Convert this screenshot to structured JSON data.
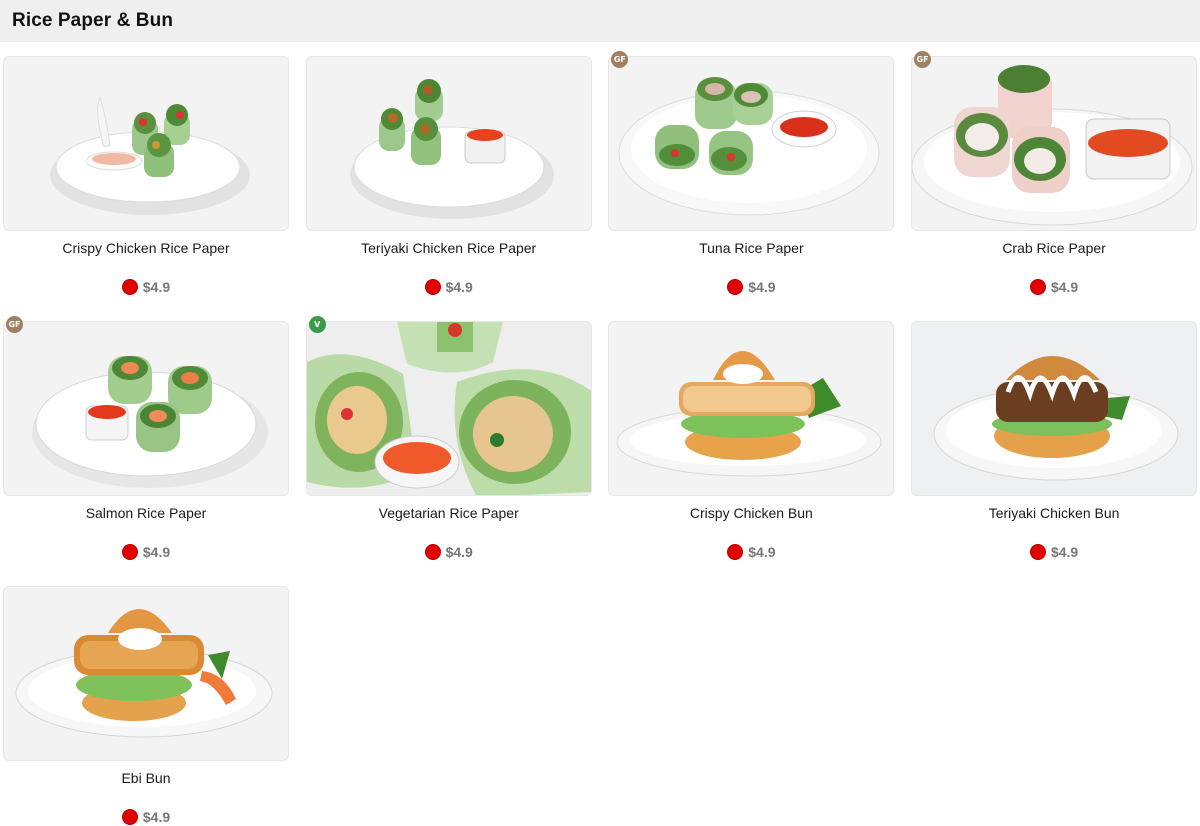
{
  "header": {
    "title": "Rice Paper & Bun"
  },
  "colors": {
    "header_bg": "#efefef",
    "price_dot": "#e00000",
    "badge_gf": "#a08060",
    "badge_v": "#3a9a4a"
  },
  "items": [
    {
      "name": "Crispy Chicken Rice Paper",
      "price": "$4.9",
      "badge": "",
      "art": "roll-sauce-cup"
    },
    {
      "name": "Teriyaki Chicken Rice Paper",
      "price": "$4.9",
      "badge": "",
      "art": "roll-sauce-cup"
    },
    {
      "name": "Tuna Rice Paper",
      "price": "$4.9",
      "badge": "GF",
      "art": "roll-sauce-bowl"
    },
    {
      "name": "Crab Rice Paper",
      "price": "$4.9",
      "badge": "GF",
      "art": "roll-sauce-cup"
    },
    {
      "name": "Salmon Rice Paper",
      "price": "$4.9",
      "badge": "GF",
      "art": "roll-sauce-cup"
    },
    {
      "name": "Vegetarian Rice Paper",
      "price": "$4.9",
      "badge": "V",
      "art": "roll-closeup"
    },
    {
      "name": "Crispy Chicken Bun",
      "price": "$4.9",
      "badge": "",
      "art": "bun"
    },
    {
      "name": "Teriyaki Chicken Bun",
      "price": "$4.9",
      "badge": "",
      "art": "bun"
    },
    {
      "name": "Ebi Bun",
      "price": "$4.9",
      "badge": "",
      "art": "bun"
    }
  ]
}
